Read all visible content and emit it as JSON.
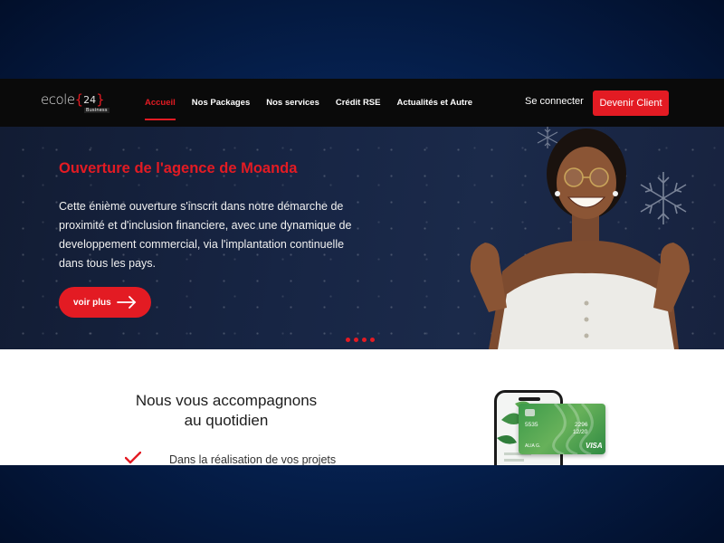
{
  "brand": {
    "logo_text": "ecole",
    "logo_number": "24",
    "logo_sub": "Business",
    "accent": "#e31b23"
  },
  "nav": {
    "items": [
      {
        "label": "Accueil",
        "active": true
      },
      {
        "label": "Nos Packages",
        "active": false
      },
      {
        "label": "Nos services",
        "active": false
      },
      {
        "label": "Crédit RSE",
        "active": false
      },
      {
        "label": "Actualités et Autre",
        "active": false
      }
    ],
    "login_label": "Se connecter",
    "signup_label": "Devenir Client"
  },
  "hero": {
    "title": "Ouverture de l'agence de Moanda",
    "text": "Cette énième ouverture s'inscrit dans notre démarche de proximité et d'inclusion financiere, avec une dynamique de developpement commercial, via l'implantation continuelle dans tous les pays.",
    "cta_label": "voir plus",
    "slide_count": 4
  },
  "section": {
    "title_line1": "Nous vous accompagnons",
    "title_line2": "au quotidien",
    "items": [
      "Dans la réalisation de vos projets"
    ]
  },
  "card": {
    "number_left": "5535",
    "number_right": "2296",
    "expiry": "12/20",
    "holder": "ALIA G.",
    "brand": "VISA"
  }
}
